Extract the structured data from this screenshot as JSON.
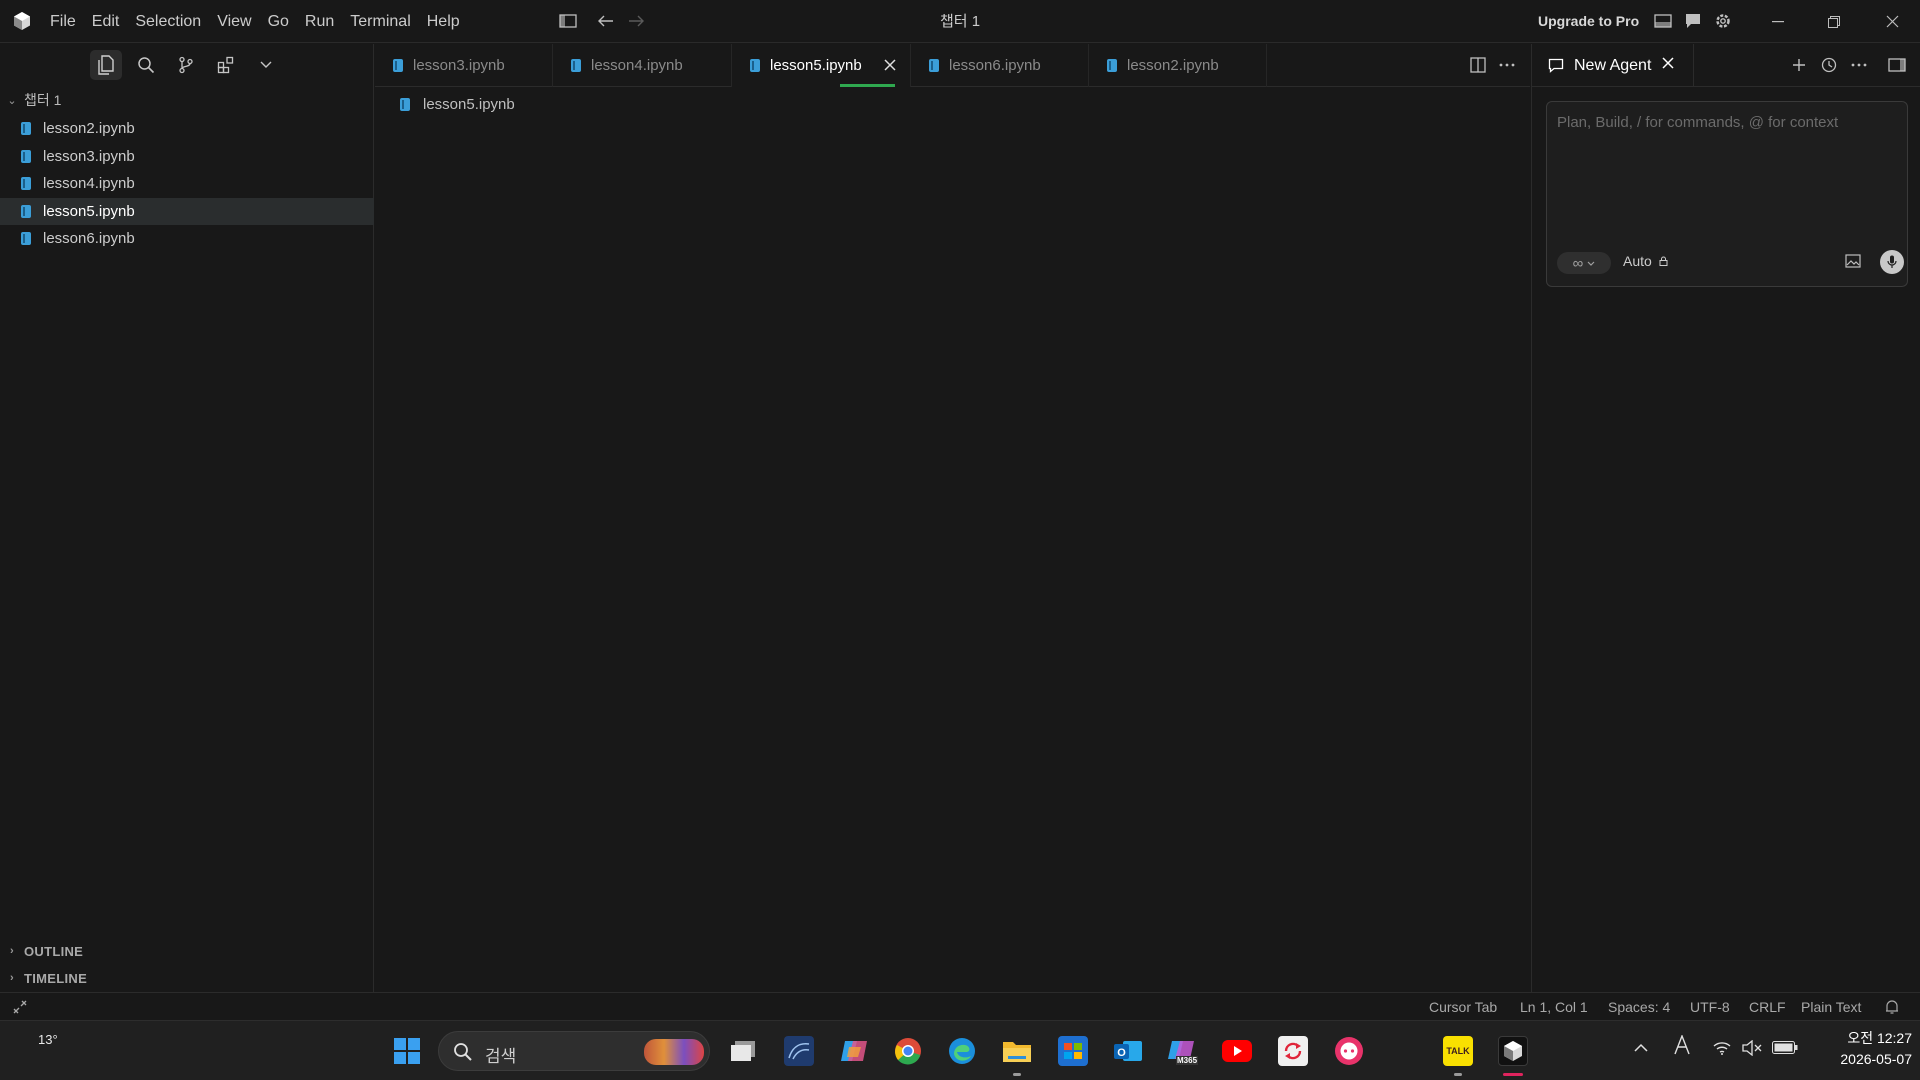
{
  "titlebar": {
    "menu": [
      "File",
      "Edit",
      "Selection",
      "View",
      "Go",
      "Run",
      "Terminal",
      "Help"
    ],
    "title": "챕터 1",
    "upgrade": "Upgrade to Pro"
  },
  "sidebar": {
    "folder": "챕터 1",
    "files": [
      "lesson2.ipynb",
      "lesson3.ipynb",
      "lesson4.ipynb",
      "lesson5.ipynb",
      "lesson6.ipynb"
    ],
    "selected_file": "lesson5.ipynb",
    "sections": [
      "OUTLINE",
      "TIMELINE"
    ]
  },
  "editor": {
    "tabs": [
      "lesson3.ipynb",
      "lesson4.ipynb",
      "lesson5.ipynb",
      "lesson6.ipynb",
      "lesson2.ipynb"
    ],
    "active_tab": "lesson5.ipynb",
    "breadcrumb": "lesson5.ipynb"
  },
  "agent": {
    "tab_label": "New Agent",
    "placeholder": "Plan, Build, / for commands, @ for context",
    "mode_icon": "infinity-icon",
    "model": "Auto"
  },
  "statusbar": {
    "items": [
      "Cursor Tab",
      "Ln 1, Col 1",
      "Spaces: 4",
      "UTF-8",
      "CRLF",
      "Plain Text"
    ]
  },
  "taskbar": {
    "weather": "13°",
    "search_placeholder": "검색",
    "time": "오전 12:27",
    "date": "2026-05-07",
    "kakao_label": "TALK",
    "m365_label": "M365"
  },
  "colors": {
    "accent": "#3b9ed8",
    "background": "#181818",
    "tab_underline": "#2fa84f"
  }
}
